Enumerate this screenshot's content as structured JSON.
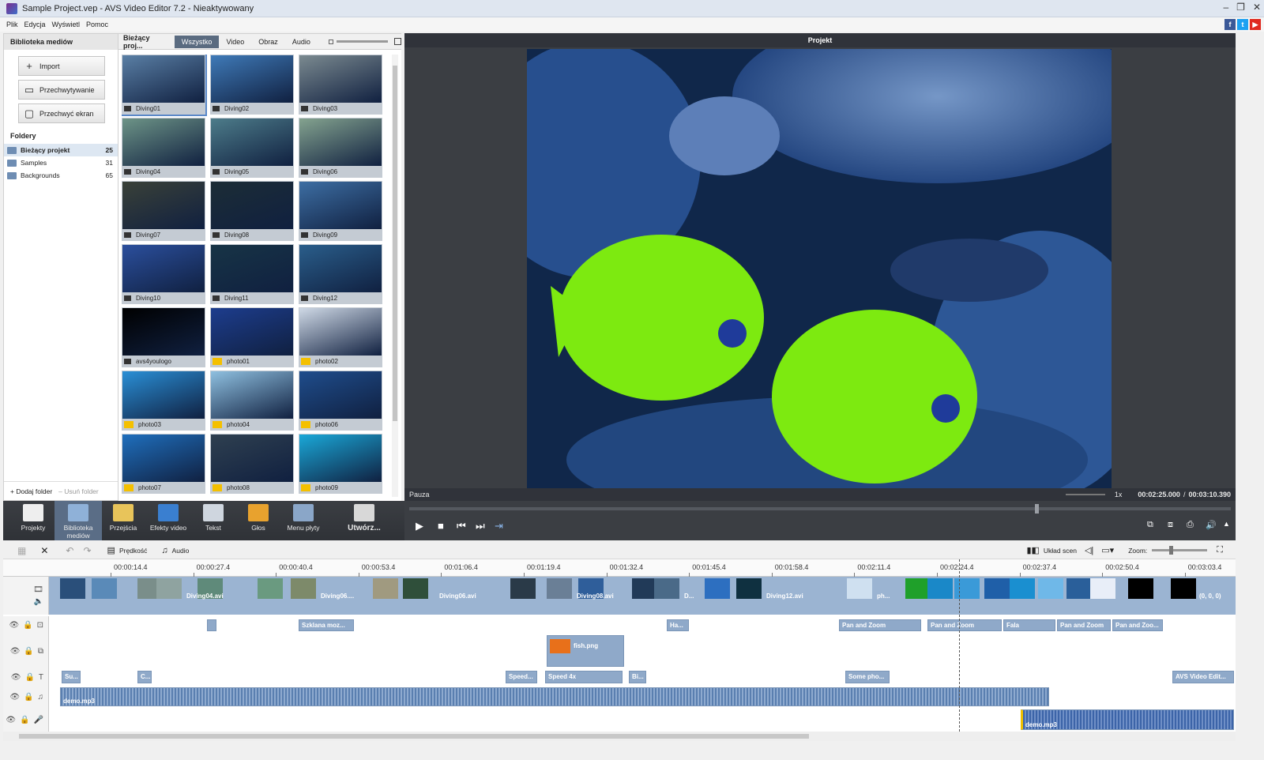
{
  "window": {
    "title": "Sample Project.vep - AVS Video Editor 7.2 - Nieaktywowany"
  },
  "menu": [
    "Plik",
    "Edycja",
    "Wyświetl",
    "Pomoc"
  ],
  "library": {
    "title": "Biblioteka mediów",
    "buttons": [
      "Import",
      "Przechwytywanie",
      "Przechwyć ekran"
    ],
    "folders_title": "Foldery",
    "folders": [
      {
        "name": "Bieżący projekt",
        "count": "25"
      },
      {
        "name": "Samples",
        "count": "31"
      },
      {
        "name": "Backgrounds",
        "count": "65"
      }
    ],
    "add_folder": "Dodaj folder",
    "remove_folder": "Usuń folder"
  },
  "media": {
    "project_label": "Bieżący proj...",
    "tabs": [
      "Wszystko",
      "Video",
      "Obraz",
      "Audio"
    ],
    "items": [
      {
        "name": "Diving01",
        "kind": "video",
        "color": "#5a7fa5"
      },
      {
        "name": "Diving02",
        "kind": "video",
        "color": "#3f7ab8"
      },
      {
        "name": "Diving03",
        "kind": "video",
        "color": "#7b8a90"
      },
      {
        "name": "Diving04",
        "kind": "video",
        "color": "#6d9487"
      },
      {
        "name": "Diving05",
        "kind": "video",
        "color": "#4d7c8a"
      },
      {
        "name": "Diving06",
        "kind": "video",
        "color": "#84a38f"
      },
      {
        "name": "Diving07",
        "kind": "video",
        "color": "#3a4138"
      },
      {
        "name": "Diving08",
        "kind": "video",
        "color": "#1c2d36"
      },
      {
        "name": "Diving09",
        "kind": "video",
        "color": "#3d6ea3"
      },
      {
        "name": "Diving10",
        "kind": "video",
        "color": "#2b4f9d"
      },
      {
        "name": "Diving11",
        "kind": "video",
        "color": "#173446"
      },
      {
        "name": "Diving12",
        "kind": "video",
        "color": "#2a5e8b"
      },
      {
        "name": "avs4youlogo",
        "kind": "video",
        "color": "#000000"
      },
      {
        "name": "photo01",
        "kind": "photo",
        "color": "#1d3d8e"
      },
      {
        "name": "photo02",
        "kind": "photo",
        "color": "#cfd9e6"
      },
      {
        "name": "photo03",
        "kind": "photo",
        "color": "#2a8fd6"
      },
      {
        "name": "photo04",
        "kind": "photo",
        "color": "#8fc0e0"
      },
      {
        "name": "photo06",
        "kind": "photo",
        "color": "#1f4d8c"
      },
      {
        "name": "photo07",
        "kind": "photo",
        "color": "#1f6fbd"
      },
      {
        "name": "photo08",
        "kind": "photo",
        "color": "#2f4050"
      },
      {
        "name": "photo09",
        "kind": "photo",
        "color": "#1aa8d8"
      }
    ]
  },
  "preview": {
    "title": "Projekt",
    "status": "Pauza",
    "speed": "1x",
    "time_current": "00:02:25.000",
    "time_separator": "/",
    "time_total": "00:03:10.390"
  },
  "toolbar": [
    "Projekty",
    "Biblioteka mediów",
    "Przejścia",
    "Efekty video",
    "Tekst",
    "Głos",
    "Menu płyty",
    "Utwórz..."
  ],
  "timeline_tools": {
    "speed": "Prędkość",
    "audio": "Audio",
    "scene_layout": "Układ scen",
    "zoom": "Zoom:"
  },
  "ruler": [
    "00:00:14.4",
    "00:00:27.4",
    "00:00:40.4",
    "00:00:53.4",
    "00:01:06.4",
    "00:01:19.4",
    "00:01:32.4",
    "00:01:45.4",
    "00:01:58.4",
    "00:02:11.4",
    "00:02:24.4",
    "00:02:37.4",
    "00:02:50.4",
    "00:03:03.4"
  ],
  "video_clips": [
    "Diving04.avi",
    "Diving06....",
    "Diving06.avi",
    "Diving08.avi",
    "D...",
    "Diving12.avi",
    "ph...",
    "(0, 0, 0)"
  ],
  "effects": [
    "Szklana moz...",
    "Ha...",
    "Pan and Zoom",
    "Pan and Zoom",
    "Fala",
    "Pan and Zoom",
    "Pan and Zoo..."
  ],
  "overlay": "fish.png",
  "texts": [
    "Su...",
    "C...",
    "Speed...",
    "Speed 4x",
    "Bi...",
    "Some pho...",
    "AVS Video Edit..."
  ],
  "audio1": "demo.mp3",
  "audio2": "demo.mp3"
}
